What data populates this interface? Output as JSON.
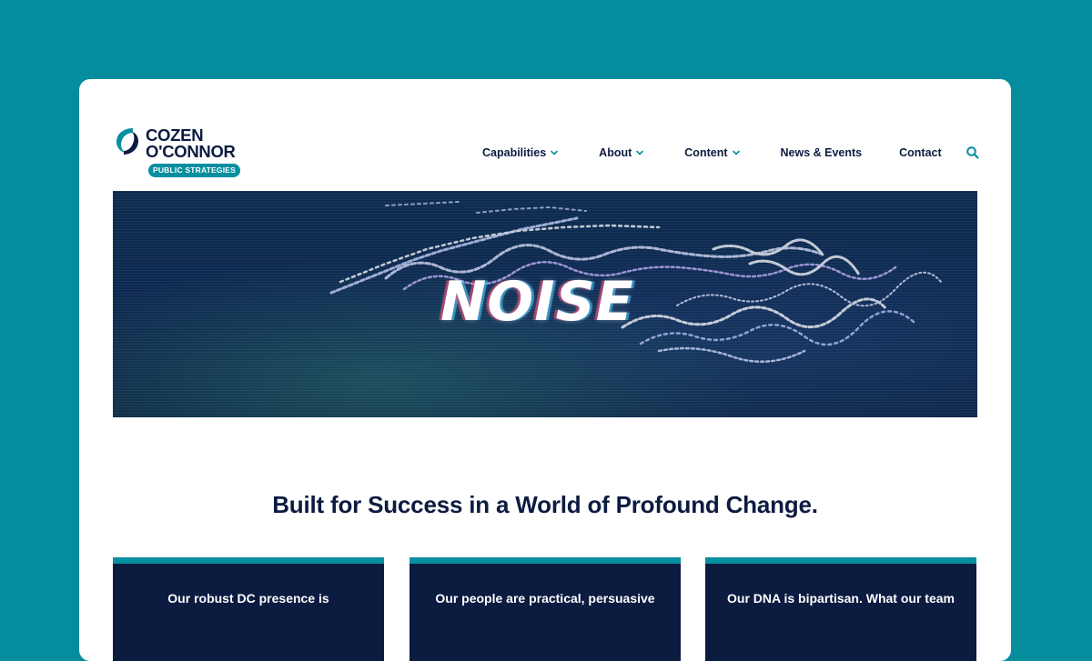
{
  "brand": {
    "name_line1": "COZEN",
    "name_line2": "O'CONNOR",
    "tag": "PUBLIC STRATEGIES",
    "color_primary": "#0c1b40",
    "color_accent": "#078f9f",
    "background": "#058d9e"
  },
  "nav": {
    "items": [
      {
        "label": "Capabilities",
        "has_dropdown": true
      },
      {
        "label": "About",
        "has_dropdown": true
      },
      {
        "label": "Content",
        "has_dropdown": true
      },
      {
        "label": "News & Events",
        "has_dropdown": false
      },
      {
        "label": "Contact",
        "has_dropdown": false
      }
    ],
    "search_icon": "search-icon"
  },
  "hero": {
    "word": "NOISE"
  },
  "main": {
    "headline": "Built for Success in a World of Profound Change."
  },
  "features": [
    {
      "text": "Our robust DC presence is"
    },
    {
      "text": "Our people are practical, persuasive"
    },
    {
      "text": "Our DNA is bipartisan. What our team"
    }
  ]
}
